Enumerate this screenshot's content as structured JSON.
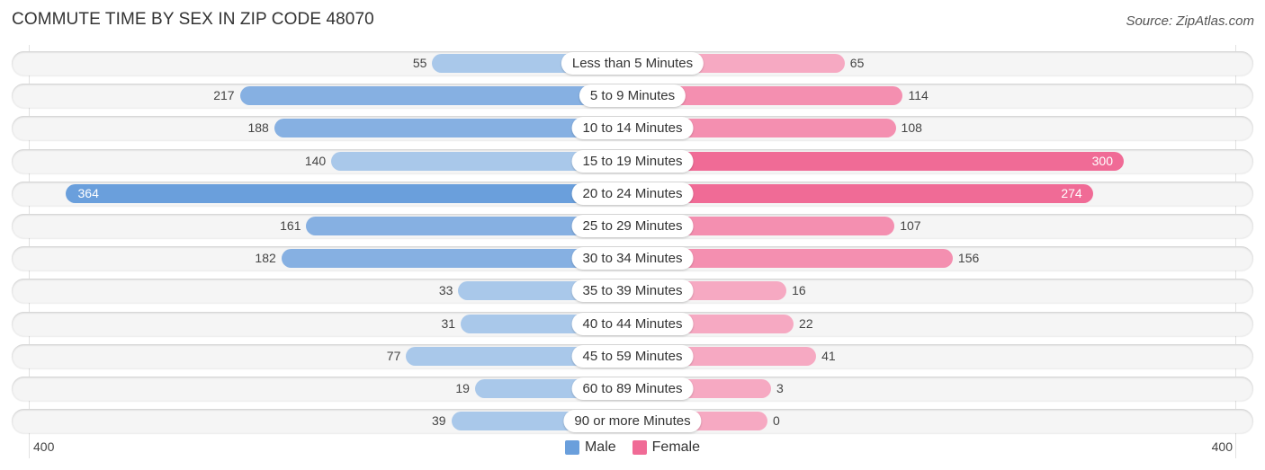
{
  "title": "COMMUTE TIME BY SEX IN ZIP CODE 48070",
  "source": "Source: ZipAtlas.com",
  "colors": {
    "male_strong": "#6a9fdc",
    "male_light": "#a9c8ea",
    "female_strong": "#f06b96",
    "female_light": "#f6a9c2",
    "row_background": "#f5f5f5"
  },
  "chart_data": {
    "type": "bar",
    "orientation": "horizontal-diverging",
    "title": "COMMUTE TIME BY SEX IN ZIP CODE 48070",
    "categories": [
      "Less than 5 Minutes",
      "5 to 9 Minutes",
      "10 to 14 Minutes",
      "15 to 19 Minutes",
      "20 to 24 Minutes",
      "25 to 29 Minutes",
      "30 to 34 Minutes",
      "35 to 39 Minutes",
      "40 to 44 Minutes",
      "45 to 59 Minutes",
      "60 to 89 Minutes",
      "90 or more Minutes"
    ],
    "series": [
      {
        "name": "Male",
        "values": [
          55,
          217,
          188,
          140,
          364,
          161,
          182,
          33,
          31,
          77,
          19,
          39
        ]
      },
      {
        "name": "Female",
        "values": [
          65,
          114,
          108,
          300,
          274,
          107,
          156,
          16,
          22,
          41,
          3,
          0
        ]
      }
    ],
    "axis": {
      "left_label": "400",
      "right_label": "400",
      "max": 400
    },
    "legend": {
      "position": "bottom-center",
      "entries": [
        "Male",
        "Female"
      ]
    },
    "xlabel": "",
    "ylabel": ""
  }
}
